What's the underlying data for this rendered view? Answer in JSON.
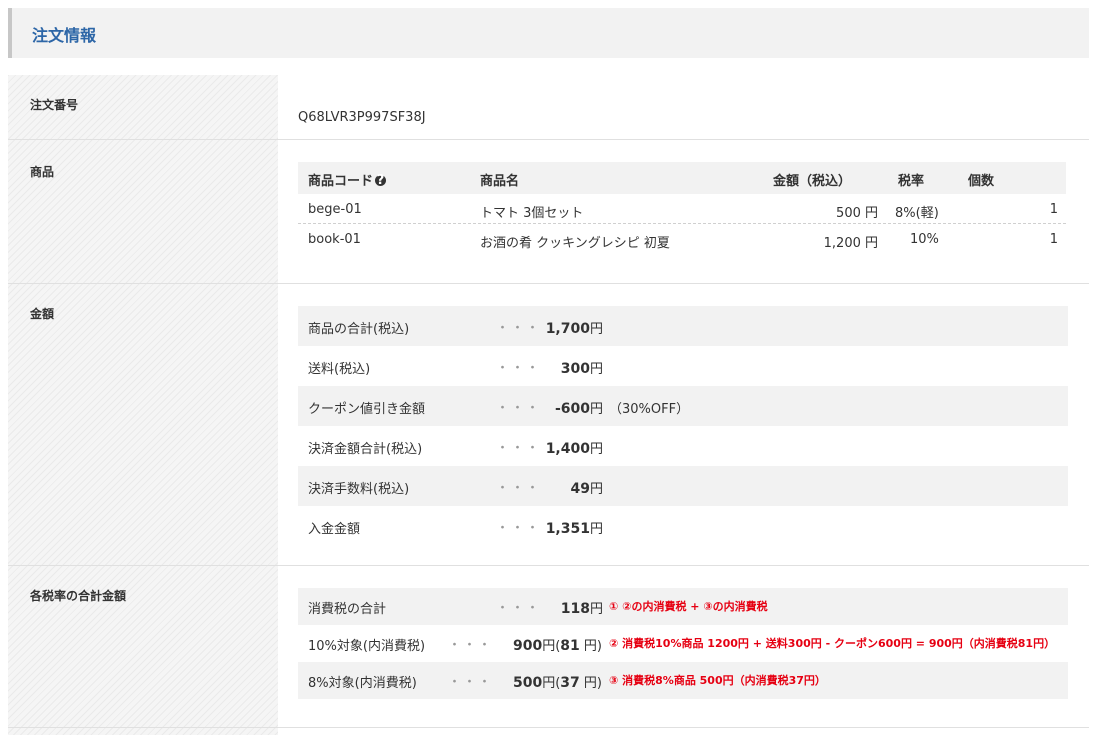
{
  "section": {
    "title": "注文情報"
  },
  "labels": {
    "order_number": "注文番号",
    "products": "商品",
    "amount": "金額",
    "tax_totals": "各税率の合計金額"
  },
  "order_number": "Q68LVR3P997SF38J",
  "product_table": {
    "headers": {
      "code": "商品コード",
      "name": "商品名",
      "price": "金額（税込）",
      "tax_rate": "税率",
      "quantity": "個数"
    },
    "help_icon": "?",
    "rows": [
      {
        "code": "bege-01",
        "name": "トマト 3個セット",
        "price": "500 円",
        "tax_rate": "8%(軽)",
        "quantity": "1"
      },
      {
        "code": "book-01",
        "name": "お酒の肴 クッキングレシピ 初夏",
        "price": "1,200 円",
        "tax_rate": "10%",
        "quantity": "1"
      }
    ]
  },
  "amounts": {
    "separator": "・・・",
    "rows": [
      {
        "label": "商品の合計(税込)",
        "value": "1,700",
        "unit": "円",
        "extra": ""
      },
      {
        "label": "送料(税込)",
        "value": "300",
        "unit": "円",
        "extra": ""
      },
      {
        "label": "クーポン値引き金額",
        "value": "-600",
        "unit": "円",
        "extra": "（30%OFF）"
      },
      {
        "label": "決済金額合計(税込)",
        "value": "1,400",
        "unit": "円",
        "extra": ""
      },
      {
        "label": "決済手数料(税込)",
        "value": "49",
        "unit": "円",
        "extra": ""
      },
      {
        "label": "入金金額",
        "value": "1,351",
        "unit": "円",
        "extra": ""
      }
    ]
  },
  "tax_totals": {
    "rows": [
      {
        "label": "消費税の合計",
        "value": "118",
        "unit": "円",
        "inner_tax": "",
        "inner_unit": "",
        "note": "① ②の内消費税 + ③の内消費税"
      },
      {
        "label": "10%対象(内消費税)",
        "value": "900",
        "unit": "円(",
        "inner_tax": "81",
        "inner_unit": " 円)",
        "note": "② 消費税10%商品 1200円 + 送料300円 - クーポン600円 = 900円（内消費税81円）"
      },
      {
        "label": "8%対象(内消費税)",
        "value": "500",
        "unit": "円(",
        "inner_tax": "37",
        "inner_unit": " 円)",
        "note": "③ 消費税8%商品 500円（内消費税37円）"
      }
    ]
  },
  "colors": {
    "title": "#2d66a7",
    "note": "#e60012",
    "shade": "#f2f2f2"
  }
}
